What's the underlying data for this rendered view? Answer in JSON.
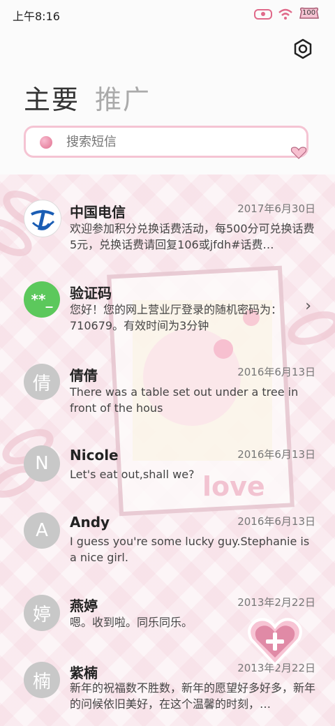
{
  "status": {
    "time": "上午8:16",
    "battery": "100"
  },
  "tabs": [
    {
      "label": "主要"
    },
    {
      "label": "推广"
    }
  ],
  "search": {
    "placeholder": "搜索短信"
  },
  "messages": [
    {
      "name": "中国电信",
      "date": "2017年6月30日",
      "avatar": "telecom-logo",
      "snippet": "欢迎参加积分兑换话费活动，每500分可兑换话费5元，兑换话费请回复106或jfdh#话费…"
    },
    {
      "name": "验证码",
      "date": "",
      "avatar_text": "**_",
      "snippet": "您好！您的网上营业厅登录的随机密码为：710679。有效时间为3分钟"
    },
    {
      "name": "倩倩",
      "date": "2016年6月13日",
      "avatar_text": "倩",
      "snippet": "There was a table set out under a tree in front of the hous"
    },
    {
      "name": "Nicole",
      "date": "2016年6月13日",
      "avatar_text": "N",
      "snippet": "Let's eat out,shall we?"
    },
    {
      "name": "Andy",
      "date": "2016年6月13日",
      "avatar_text": "A",
      "snippet": "I guess you're some lucky guy.Stephanie is a nice girl."
    },
    {
      "name": "燕婷",
      "date": "2013年2月22日",
      "avatar_text": "婷",
      "snippet": "嗯。收到啦。同乐同乐。"
    },
    {
      "name": "紫楠",
      "date": "2013年2月22日",
      "avatar_text": "楠",
      "snippet": "新年的祝福数不胜数，新年的愿望好多好多，新年的问候依旧美好，在这个温馨的时刻，…"
    }
  ],
  "decoration": {
    "love_text": "love"
  },
  "colors": {
    "accent_pink": "#f5c4d3",
    "verify_green": "#5cc85c",
    "telecom_blue": "#1a5db4"
  }
}
